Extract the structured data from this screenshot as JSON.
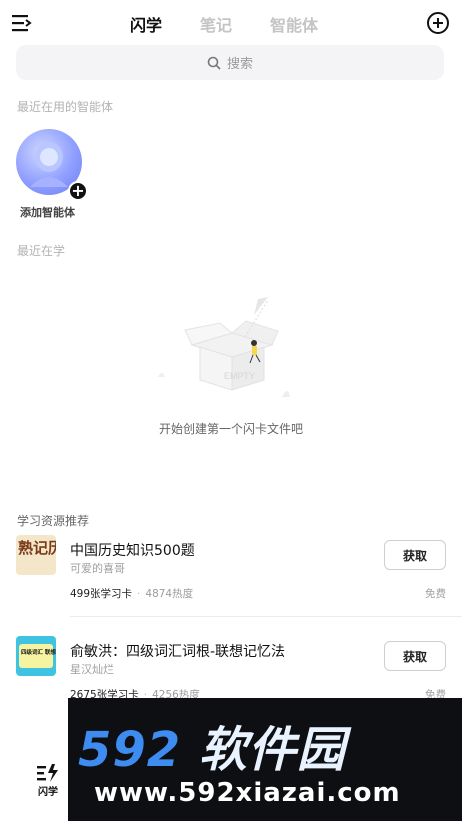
{
  "header": {
    "tabs": [
      {
        "label": "闪学",
        "active": true
      },
      {
        "label": "笔记",
        "active": false
      },
      {
        "label": "智能体",
        "active": false
      }
    ]
  },
  "search": {
    "placeholder": "搜索"
  },
  "recent_agents": {
    "section_label": "最近在用的智能体",
    "add_label": "添加智能体"
  },
  "recent_study": {
    "section_label": "最近在学",
    "empty_badge": "EMPTY",
    "empty_text": "开始创建第一个闪卡文件吧"
  },
  "resources": {
    "section_label": "学习资源推荐",
    "items": [
      {
        "title": "中国历史知识500题",
        "author": "可爱的喜哥",
        "cards": "499张学习卡",
        "heat": "4874热度",
        "price": "免费",
        "button": "获取",
        "thumb_text": "熟记历史"
      },
      {
        "title": "俞敏洪：四级词汇词根-联想记忆法",
        "author": "星汉灿烂",
        "cards": "2675张学习卡",
        "heat": "4256热度",
        "price": "免费",
        "button": "获取",
        "thumb_text": "四级词汇 联想记忆法"
      }
    ]
  },
  "bottom_nav": {
    "items": [
      {
        "label": "闪学",
        "icon": "flash-learn-icon"
      }
    ]
  },
  "watermark": {
    "brand_digits": "592",
    "brand_cn": "软件园",
    "url": "www.592xiazai.com"
  },
  "colors": {
    "accent": "#111111",
    "inactive_tab": "#c4c4c4",
    "watermark_blue": "#3f8cf1"
  }
}
